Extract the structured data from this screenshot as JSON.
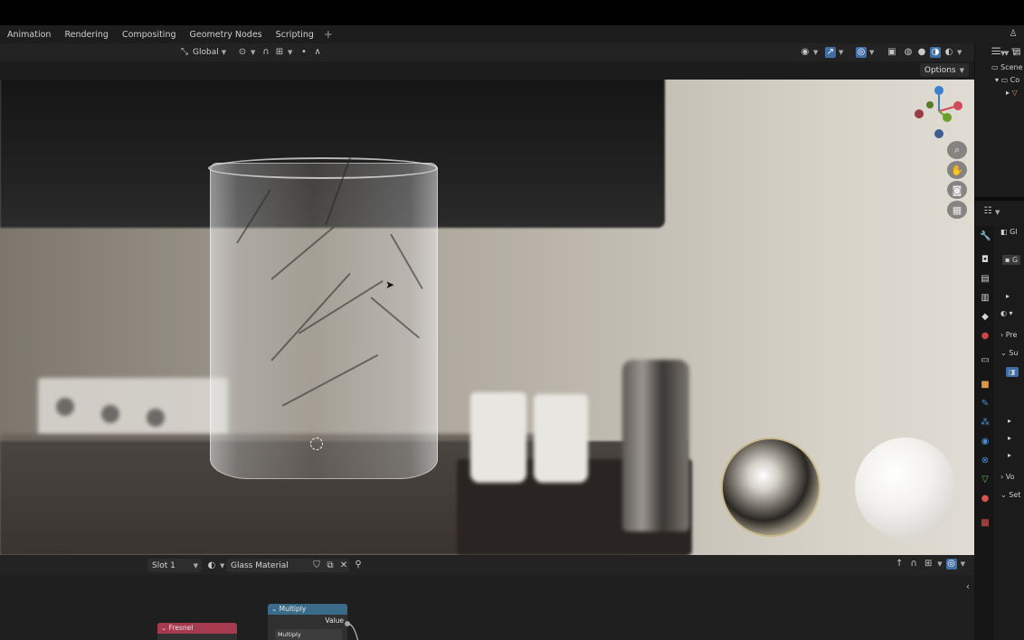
{
  "workspace_tabs": [
    "Animation",
    "Rendering",
    "Compositing",
    "Geometry Nodes",
    "Scripting"
  ],
  "tab_add_label": "+",
  "viewport_header": {
    "orientation_label": "Global",
    "options_label": "Options"
  },
  "node_editor_header": {
    "slot_label": "Slot 1",
    "material_name": "Glass Material"
  },
  "nodes": {
    "fresnel_title": "Fresnel",
    "multiply_title": "Multiply",
    "multiply_output": "Value",
    "multiply_operation": "Multiply"
  },
  "outliner": {
    "row1": "Scene",
    "row2": "Co"
  },
  "properties": {
    "object_name": "Gl",
    "object_name_field": "G",
    "preview": "Pre",
    "surface": "Su",
    "volume": "Vo",
    "settings": "Set"
  },
  "colors": {
    "fresnel_header": "#a63a4e",
    "multiply_header": "#3a6c8a",
    "accent_blue": "#3f6fa6",
    "gizmo_x": "#d04a5a",
    "gizmo_y": "#6aa02c",
    "gizmo_z": "#3b7fd0"
  }
}
